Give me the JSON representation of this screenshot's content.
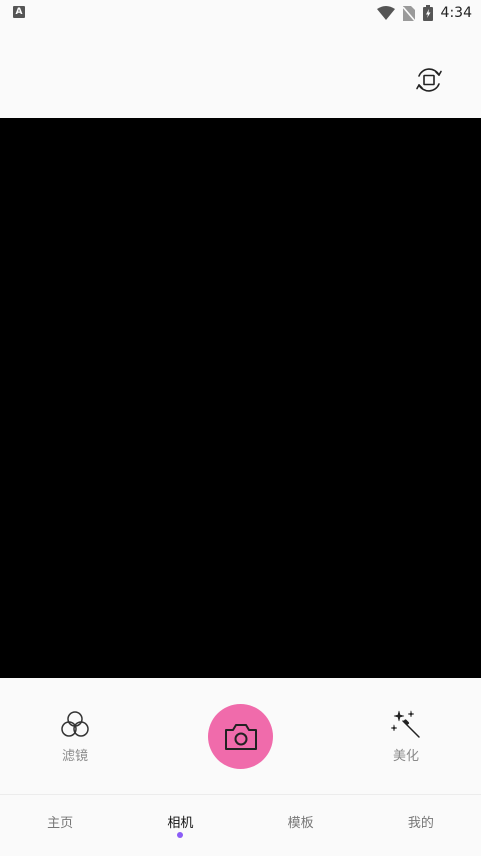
{
  "status_bar": {
    "left_icon_letter": "A",
    "time": "4:34",
    "icons": [
      "wifi-icon",
      "no-sim-icon",
      "battery-charging-icon"
    ]
  },
  "top_bar": {
    "switch_camera_icon": "switch-camera-icon"
  },
  "controls": {
    "filter": {
      "icon": "filter-icon",
      "label": "滤镜"
    },
    "shutter": {
      "icon": "camera-icon",
      "color": "#f06bab"
    },
    "beauty": {
      "icon": "magic-wand-icon",
      "label": "美化"
    }
  },
  "tabs": [
    {
      "label": "主页",
      "active": false
    },
    {
      "label": "相机",
      "active": true
    },
    {
      "label": "模板",
      "active": false
    },
    {
      "label": "我的",
      "active": false
    }
  ],
  "colors": {
    "accent": "#f06bab",
    "active_dot": "#8b5cf6",
    "viewfinder": "#000000"
  }
}
